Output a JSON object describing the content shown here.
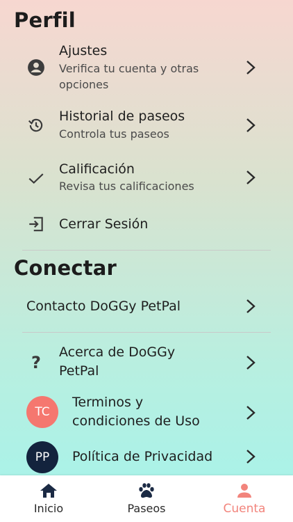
{
  "perfil": {
    "title": "Perfil",
    "items": [
      {
        "label": "Ajustes",
        "sub_line1": "Verifica tu cuenta y otras",
        "sub_line2": "opciones",
        "icon": "account-circle-icon"
      },
      {
        "label": "Historial de paseos",
        "sub": "Controla tus paseos",
        "icon": "history-icon"
      },
      {
        "label": "Calificación",
        "sub": "Revisa tus calificaciones",
        "icon": "checkmark-icon"
      },
      {
        "label": "Cerrar Sesión",
        "icon": "logout-icon"
      }
    ]
  },
  "conectar": {
    "title": "Conectar",
    "contact": "Contacto DoGGy PetPal",
    "about_line1": "Acerca de DoGGy",
    "about_line2": "PetPal",
    "about_icon": "?",
    "terms": {
      "avatar": "TC",
      "line1": "Terminos y",
      "line2": "condiciones de Uso",
      "color": "#f5776f"
    },
    "privacy": {
      "avatar": "PP",
      "label": "Política de Privacidad",
      "color": "#13233d"
    }
  },
  "tabs": [
    {
      "label": "Inicio",
      "icon": "home-icon"
    },
    {
      "label": "Paseos",
      "icon": "paw-icon"
    },
    {
      "label": "Cuenta",
      "icon": "person-icon",
      "active": true
    }
  ],
  "colors": {
    "active_tab": "#f2847c",
    "inactive_tab": "#1b2a44"
  }
}
